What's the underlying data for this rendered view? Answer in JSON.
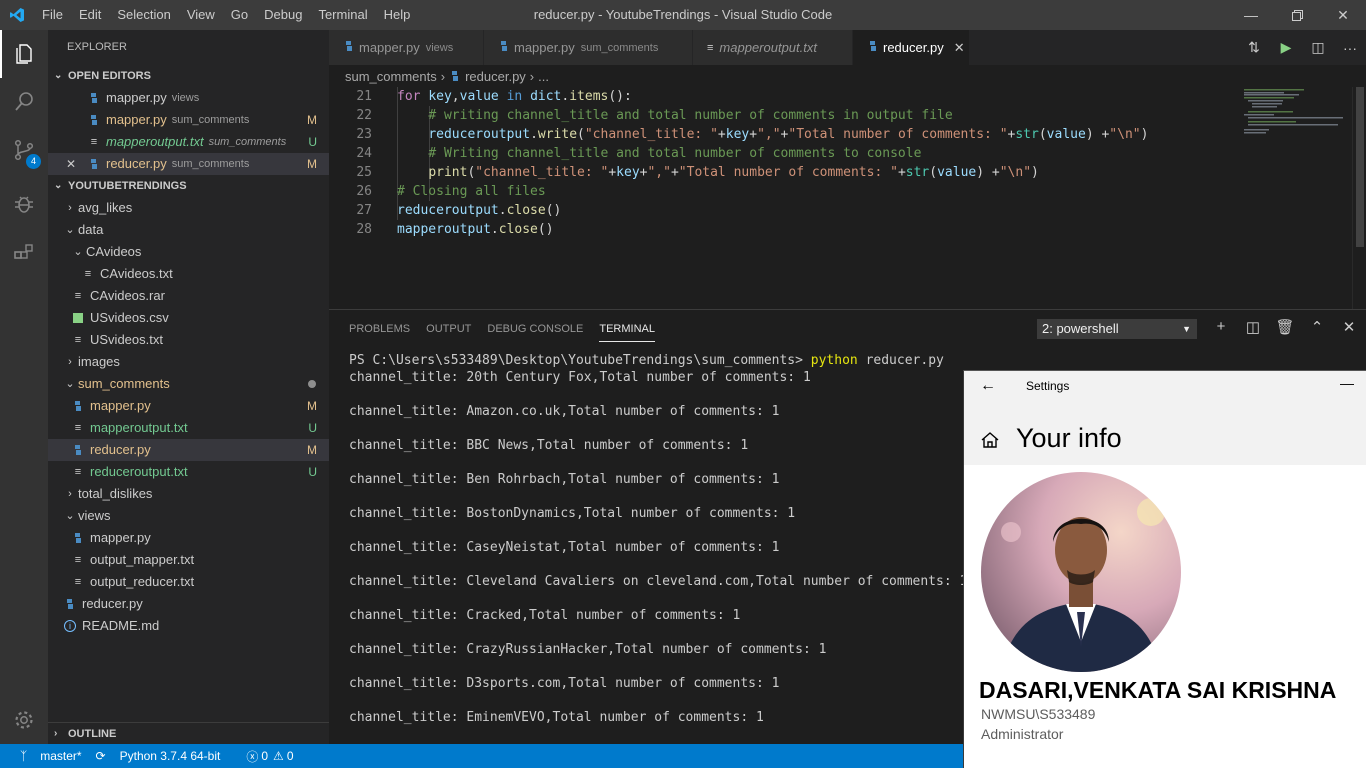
{
  "titlebar": {
    "menu": [
      "File",
      "Edit",
      "Selection",
      "View",
      "Go",
      "Debug",
      "Terminal",
      "Help"
    ],
    "window_title": "reducer.py - YoutubeTrendings - Visual Studio Code"
  },
  "activity": {
    "scm_badge": "4"
  },
  "sidebar": {
    "title": "EXPLORER",
    "open_editors_label": "OPEN EDITORS",
    "open_editors": [
      {
        "name": "mapper.py",
        "desc": "views",
        "status": ""
      },
      {
        "name": "mapper.py",
        "desc": "sum_comments",
        "status": "M"
      },
      {
        "name": "mapperoutput.txt",
        "desc": "sum_comments",
        "status": "U"
      },
      {
        "name": "reducer.py",
        "desc": "sum_comments",
        "status": "M"
      }
    ],
    "project_label": "YOUTUBETRENDINGS",
    "tree": {
      "avg_likes": "avg_likes",
      "data": "data",
      "cavideos_folder": "CAvideos",
      "cavideos_txt": "CAvideos.txt",
      "cavideos_rar": "CAvideos.rar",
      "usvideos_csv": "USvideos.csv",
      "usvideos_txt": "USvideos.txt",
      "images": "images",
      "sum_comments": "sum_comments",
      "sc_mapper": "mapper.py",
      "sc_mapperoutput": "mapperoutput.txt",
      "sc_reducer": "reducer.py",
      "sc_reduceroutput": "reduceroutput.txt",
      "total_dislikes": "total_dislikes",
      "views": "views",
      "v_mapper": "mapper.py",
      "v_output_mapper": "output_mapper.txt",
      "v_output_reducer": "output_reducer.txt",
      "reducer": "reducer.py",
      "readme": "README.md",
      "status_M": "M",
      "status_U": "U"
    },
    "outline_label": "OUTLINE"
  },
  "tabs": [
    {
      "name": "mapper.py",
      "desc": "views"
    },
    {
      "name": "mapper.py",
      "desc": "sum_comments"
    },
    {
      "name": "mapperoutput.txt",
      "desc": ""
    },
    {
      "name": "reducer.py",
      "desc": ""
    }
  ],
  "breadcrumb": {
    "folder": "sum_comments",
    "file": "reducer.py",
    "more": "..."
  },
  "editor": {
    "line_numbers": [
      "21",
      "22",
      "23",
      "24",
      "25",
      "26",
      "27",
      "28"
    ]
  },
  "panel": {
    "tabs": [
      "PROBLEMS",
      "OUTPUT",
      "DEBUG CONSOLE",
      "TERMINAL"
    ],
    "terminal_select": "2: powershell",
    "prompt": "PS C:\\Users\\s533489\\Desktop\\YoutubeTrendings\\sum_comments> ",
    "command": "python",
    "command_arg": " reducer.py",
    "output_lines": [
      "channel_title: 20th Century Fox,Total number of comments: 1",
      "",
      "channel_title: Amazon.co.uk,Total number of comments: 1",
      "",
      "channel_title: BBC News,Total number of comments: 1",
      "",
      "channel_title: Ben Rohrbach,Total number of comments: 1",
      "",
      "channel_title: BostonDynamics,Total number of comments: 1",
      "",
      "channel_title: CaseyNeistat,Total number of comments: 1",
      "",
      "channel_title: Cleveland Cavaliers on cleveland.com,Total number of comments: 1",
      "",
      "channel_title: Cracked,Total number of comments: 1",
      "",
      "channel_title: CrazyRussianHacker,Total number of comments: 1",
      "",
      "channel_title: D3sports.com,Total number of comments: 1",
      "",
      "channel_title: EminemVEVO,Total number of comments: 1"
    ]
  },
  "statusbar": {
    "branch": "master*",
    "python": "Python 3.7.4 64-bit",
    "errors": "0",
    "warnings": "0"
  },
  "settings": {
    "title": "Settings",
    "heading": "Your info",
    "user_name": "DASARI,VENKATA SAI KRISHNA",
    "account": "NWMSU\\S533489",
    "role": "Administrator"
  },
  "colors": {
    "accent": "#007acc",
    "modified": "#e2c08d",
    "untracked": "#73c991"
  }
}
